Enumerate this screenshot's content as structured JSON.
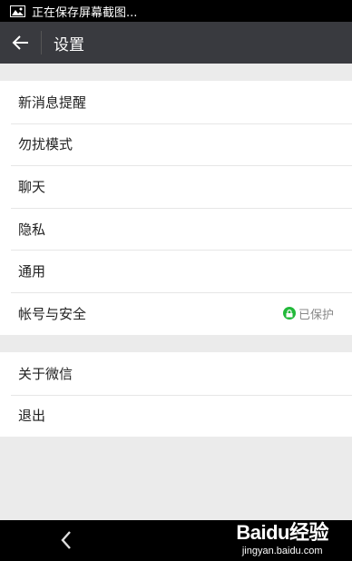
{
  "status_bar": {
    "text": "正在保存屏幕截图...",
    "icon": "image-icon"
  },
  "header": {
    "title": "设置",
    "back_icon": "arrow-left-icon"
  },
  "groups": [
    {
      "items": [
        {
          "label": "新消息提醒"
        },
        {
          "label": "勿扰模式"
        },
        {
          "label": "聊天"
        },
        {
          "label": "隐私"
        },
        {
          "label": "通用"
        },
        {
          "label": "帐号与安全",
          "status": "已保护",
          "status_icon": "lock-icon",
          "status_color": "#22b93a"
        }
      ]
    },
    {
      "items": [
        {
          "label": "关于微信"
        },
        {
          "label": "退出"
        }
      ]
    }
  ],
  "nav_bar": {
    "back_icon": "chevron-left-icon"
  },
  "watermark": {
    "brand": "Baidu经验",
    "url": "jingyan.baidu.com"
  },
  "colors": {
    "app_bar": "#393a3f",
    "background": "#ebebeb",
    "accent_green": "#22b93a"
  }
}
